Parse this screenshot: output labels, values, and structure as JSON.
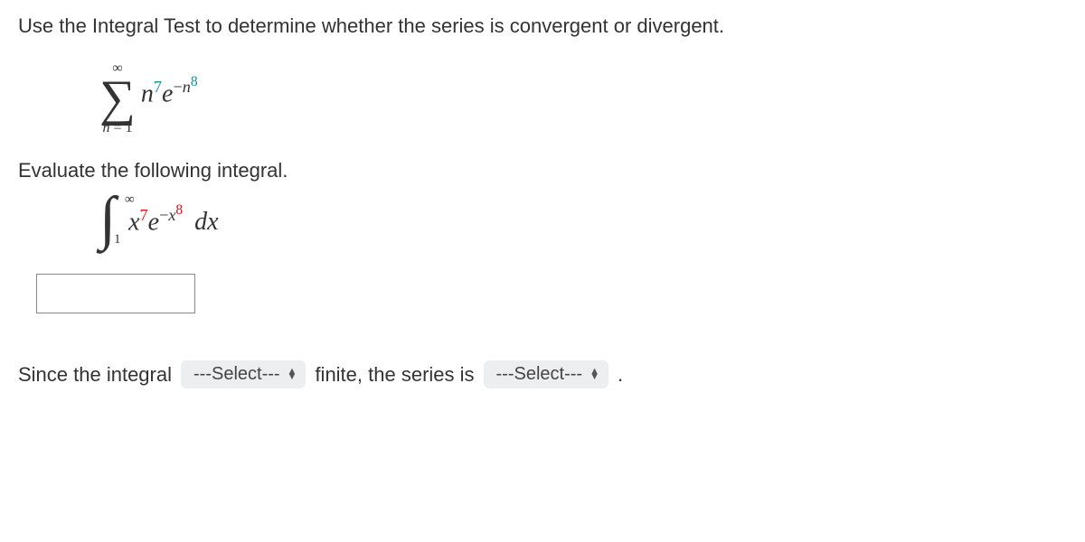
{
  "prompt": "Use the Integral Test to determine whether the series is convergent or divergent.",
  "sum": {
    "upper": "∞",
    "lower_var": "n",
    "lower_eq": " = ",
    "lower_val": "1",
    "term_base1": "n",
    "term_exp1": "7",
    "term_e": "e",
    "term_neg": "−",
    "term_base2": "n",
    "term_exp2": "8"
  },
  "sub_prompt": "Evaluate the following integral.",
  "integral": {
    "upper": "∞",
    "lower": "1",
    "base1": "x",
    "exp1": "7",
    "e": "e",
    "neg": "−",
    "base2": "x",
    "exp2": "8",
    "dx_d": "d",
    "dx_x": "x"
  },
  "answer_value": "",
  "conclusion": {
    "part1": "Since the integral",
    "select_placeholder": "---Select---",
    "part2": "finite, the series is",
    "period": "."
  }
}
